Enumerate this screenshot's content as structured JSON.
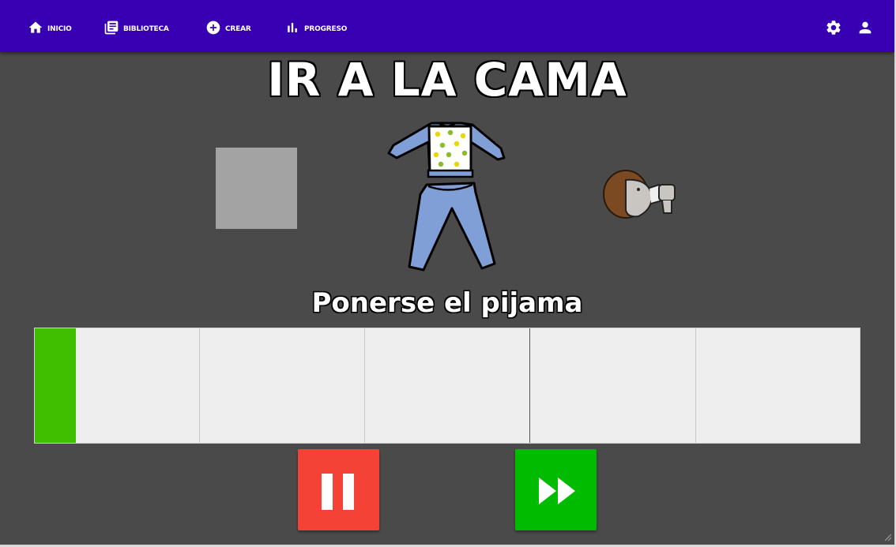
{
  "nav": {
    "items": [
      {
        "label": "Inicio",
        "icon": "home-icon"
      },
      {
        "label": "Biblioteca",
        "icon": "library-icon"
      },
      {
        "label": "Crear",
        "icon": "add-circle-icon"
      },
      {
        "label": "Progreso",
        "icon": "bar-chart-icon"
      }
    ],
    "right_icons": [
      "settings-icon",
      "account-icon"
    ],
    "color": "#3700b3"
  },
  "routine": {
    "title": "IR A LA CAMA",
    "current_step": "Ponerse el pijama",
    "current_image": "pajama-illustration",
    "next_image": "child-drinking-illustration",
    "previous_image": "empty-placeholder"
  },
  "progress": {
    "segments": 5,
    "fill_fraction_of_first_segment": 0.25,
    "fill_color": "#3fbf00"
  },
  "controls": {
    "pause": {
      "icon": "pause-icon",
      "color": "#f44336"
    },
    "skip": {
      "icon": "fast-forward-icon",
      "color": "#00bb00"
    }
  }
}
